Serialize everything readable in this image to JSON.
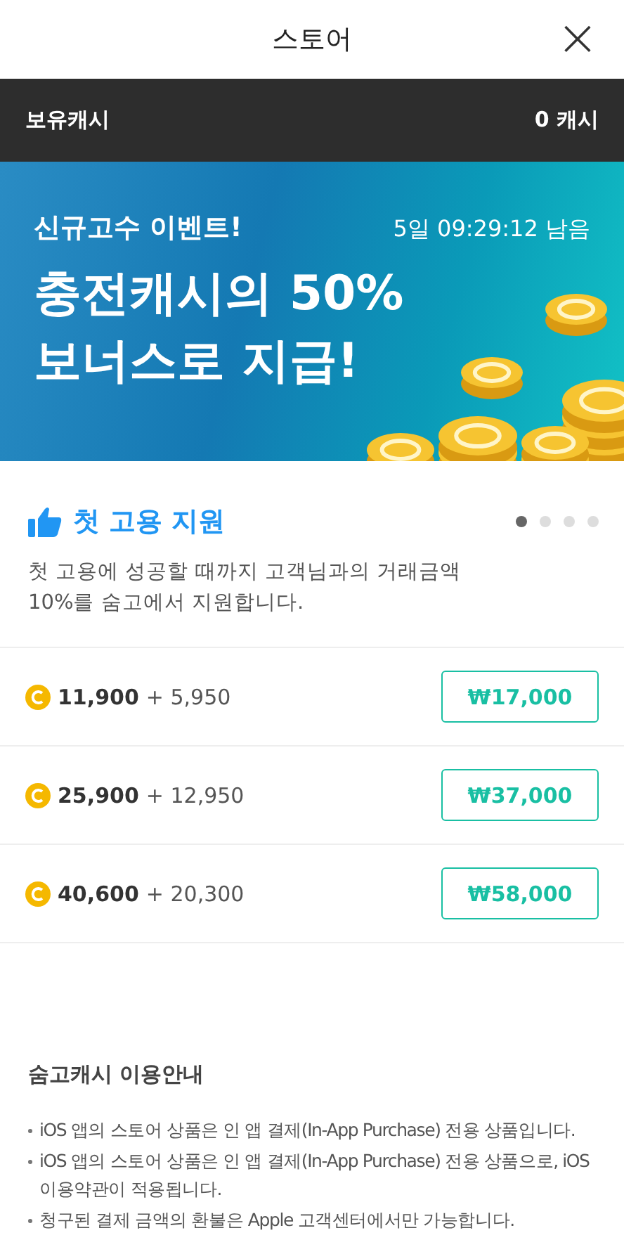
{
  "header": {
    "title": "스토어",
    "close": "×"
  },
  "balance": {
    "label": "보유캐시",
    "value": "0 캐시"
  },
  "banner": {
    "tag": "신규고수 이벤트!",
    "countdown": "5일 09:29:12 남음",
    "headline": [
      "충전캐시의 50%",
      "보너스로 지급!"
    ]
  },
  "promo": {
    "title": "첫 고용 지원",
    "description": [
      "첫 고용에 성공할 때까지 고객님과의 거래금액",
      "10%를 숨고에서 지원합니다."
    ],
    "dots": [
      {
        "selected": true
      },
      {
        "selected": false
      },
      {
        "selected": false
      },
      {
        "selected": false
      }
    ]
  },
  "packages": [
    {
      "cash": "11,900",
      "bonus": "+ 5,950",
      "price": "₩17,000"
    },
    {
      "cash": "25,900",
      "bonus": "+ 12,950",
      "price": "₩37,000"
    },
    {
      "cash": "40,600",
      "bonus": "+ 20,300",
      "price": "₩58,000"
    }
  ],
  "guide": {
    "title": "숨고캐시 이용안내",
    "items": [
      "iOS 앱의 스토어 상품은 인 앱 결제(In-App Purchase) 전용 상품입니다.",
      "iOS 앱의 스토어 상품은 인 앱 결제(In-App Purchase) 전용 상품으로, iOS 이용약관이 적용됩니다.",
      "청구된 결제 금액의 환불은 Apple 고객센터에서만 가능합니다."
    ]
  }
}
